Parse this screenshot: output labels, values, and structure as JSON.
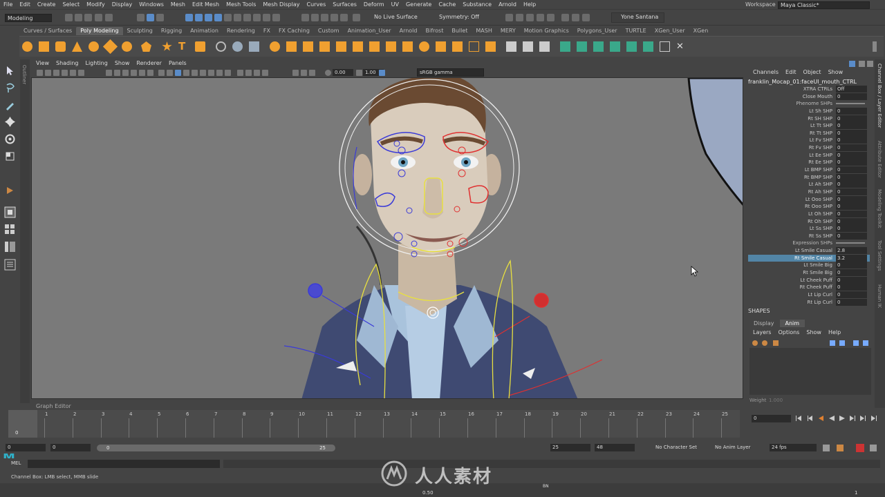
{
  "menubar": {
    "items": [
      "File",
      "Edit",
      "Create",
      "Select",
      "Modify",
      "Display",
      "Windows",
      "Mesh",
      "Edit Mesh",
      "Mesh Tools",
      "Mesh Display",
      "Curves",
      "Surfaces",
      "Deform",
      "UV",
      "Generate",
      "Cache",
      "Substance",
      "Arnold",
      "Help"
    ],
    "workspace_label": "Workspace :",
    "workspace_value": "Maya Classic*"
  },
  "statusline": {
    "mode": "Modeling",
    "live_surface": "No Live Surface",
    "symmetry": "Symmetry: Off",
    "user": "Yone Santana"
  },
  "shelf": {
    "tabs": [
      "Curves / Surfaces",
      "Poly Modeling",
      "Sculpting",
      "Rigging",
      "Animation",
      "Rendering",
      "FX",
      "FX Caching",
      "Custom",
      "Animation_User",
      "Arnold",
      "Bifrost",
      "Bullet",
      "MASH",
      "MERY",
      "Motion Graphics",
      "Polygons_User",
      "TURTLE",
      "XGen_User",
      "XGen"
    ],
    "active_tab": "Poly Modeling"
  },
  "toolbox": {
    "logo": "M"
  },
  "outliner_strip": "Outliner",
  "viewport": {
    "menu": [
      "View",
      "Shading",
      "Lighting",
      "Show",
      "Renderer",
      "Panels"
    ],
    "exposure": "0.00",
    "gamma": "1.00",
    "color_space": "sRGB gamma"
  },
  "channelbox": {
    "menu": [
      "Channels",
      "Edit",
      "Object",
      "Show"
    ],
    "object_name": "franklin_Mocap_01:faceUI_mouth_CTRL",
    "channels": [
      {
        "label": "XTRA CTRLs",
        "value": "Off"
      },
      {
        "label": "Close Mouth",
        "value": "0"
      },
      {
        "label": "Phenome SHPs",
        "value": ""
      },
      {
        "label": "Lt Sh SHP",
        "value": "0"
      },
      {
        "label": "Rt SH SHP",
        "value": "0"
      },
      {
        "label": "Lt Tt SHP",
        "value": "0"
      },
      {
        "label": "Rt Tt SHP",
        "value": "0"
      },
      {
        "label": "Lt Fv SHP",
        "value": "0"
      },
      {
        "label": "Rt Fv SHP",
        "value": "0"
      },
      {
        "label": "Lt Ee SHP",
        "value": "0"
      },
      {
        "label": "Rt Ee SHP",
        "value": "0"
      },
      {
        "label": "Lt BMP SHP",
        "value": "0"
      },
      {
        "label": "Rt BMP SHP",
        "value": "0"
      },
      {
        "label": "Lt Ah SHP",
        "value": "0"
      },
      {
        "label": "Rt Ah SHP",
        "value": "0"
      },
      {
        "label": "Lt Ooo SHP",
        "value": "0"
      },
      {
        "label": "Rt Ooo SHP",
        "value": "0"
      },
      {
        "label": "Lt Oh SHP",
        "value": "0"
      },
      {
        "label": "Rt Oh SHP",
        "value": "0"
      },
      {
        "label": "Lt Ss SHP",
        "value": "0"
      },
      {
        "label": "Rt Ss SHP",
        "value": "0"
      },
      {
        "label": "Expression SHPs",
        "value": ""
      },
      {
        "label": "Lt Smile Casual",
        "value": "2.8"
      },
      {
        "label": "Rt Smile Casual",
        "value": "3.2"
      },
      {
        "label": "Lt Smile Big",
        "value": "0"
      },
      {
        "label": "Rt Smile Big",
        "value": "0"
      },
      {
        "label": "Lt Cheek Puff",
        "value": "0"
      },
      {
        "label": "Rt Cheek Puff",
        "value": "0"
      },
      {
        "label": "Lt Lip Curl",
        "value": "0"
      },
      {
        "label": "Rt Lip Curl",
        "value": "0"
      }
    ],
    "selected_channel": "Rt Smile Casual",
    "shapes_label": "SHAPES",
    "layer_tabs": [
      "Display",
      "Anim"
    ],
    "active_layer_tab": "Anim",
    "layer_menu": [
      "Layers",
      "Options",
      "Show",
      "Help"
    ],
    "weight_label": "Weight",
    "weight_value": "1.000"
  },
  "right_strip": [
    "Channel Box / Layer Editor",
    "Attribute Editor",
    "Modeling Toolkit",
    "Tool Settings",
    "Human IK"
  ],
  "graph_editor_label": "Graph Editor",
  "timeline": {
    "ticks": [
      "0",
      "1",
      "2",
      "3",
      "4",
      "5",
      "6",
      "7",
      "8",
      "9",
      "10",
      "11",
      "12",
      "13",
      "14",
      "15",
      "16",
      "17",
      "18",
      "19",
      "20",
      "21",
      "22",
      "23",
      "24",
      "25"
    ],
    "current_frame": "0",
    "frame_field": "0"
  },
  "range": {
    "start": "0",
    "anim_start": "0",
    "slider_start": "0",
    "slider_end": "25",
    "anim_end": "25",
    "end": "48",
    "character_set": "No Character Set",
    "anim_layer": "No Anim Layer",
    "fps": "24 fps"
  },
  "cmdline": {
    "label": "MEL"
  },
  "helpline": {
    "text": "Channel Box: LMB select, MMB slide"
  },
  "bottom": {
    "value": "0.50",
    "bn": "BN",
    "page": "1"
  },
  "watermark": {
    "text": "人人素材"
  },
  "colors": {
    "selection": "#5285a6",
    "accent": "#2fb0c8",
    "viewport_bg": "#7a7a7a",
    "rig_left": "#3a3ad8",
    "rig_right": "#e03030",
    "rig_yellow": "#e8e040"
  }
}
